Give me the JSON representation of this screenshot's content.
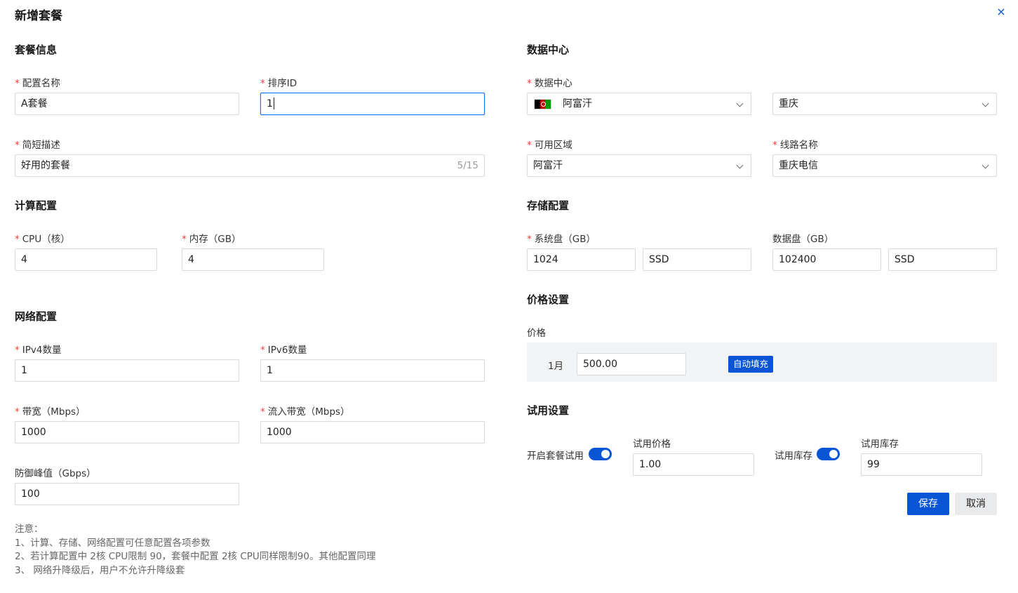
{
  "dialog": {
    "title": "新增套餐",
    "close": "×"
  },
  "package_info": {
    "title": "套餐信息",
    "name": {
      "label": "配置名称",
      "value": "A套餐"
    },
    "sort_id": {
      "label": "排序ID",
      "value": "1"
    },
    "description": {
      "label": "简短描述",
      "value": "好用的套餐",
      "counter": "5/15"
    }
  },
  "datacenter": {
    "title": "数据中心",
    "label": "数据中心",
    "country": "阿富汗",
    "city": "重庆",
    "zone": {
      "label": "可用区域",
      "value": "阿富汗"
    },
    "line": {
      "label": "线路名称",
      "value": "重庆电信"
    }
  },
  "compute": {
    "title": "计算配置",
    "cpu": {
      "label": "CPU（核）",
      "value": "4"
    },
    "memory": {
      "label": "内存（GB）",
      "value": "4"
    }
  },
  "storage": {
    "title": "存储配置",
    "system_disk": {
      "label": "系统盘（GB）",
      "value": "1024",
      "type": "SSD"
    },
    "data_disk": {
      "label": "数据盘（GB）",
      "value": "102400",
      "type": "SSD"
    }
  },
  "network": {
    "title": "网络配置",
    "ipv4": {
      "label": "IPv4数量",
      "value": "1"
    },
    "ipv6": {
      "label": "IPv6数量",
      "value": "1"
    },
    "bandwidth": {
      "label": "带宽（Mbps）",
      "value": "1000"
    },
    "inbound": {
      "label": "流入带宽（Mbps）",
      "value": "1000"
    },
    "ddos": {
      "label": "防御峰值（Gbps）",
      "value": "100"
    }
  },
  "price": {
    "title": "价格设置",
    "label": "价格",
    "period": "1月",
    "value": "500.00",
    "autofill": "自动填充"
  },
  "trial": {
    "title": "试用设置",
    "enable_label": "开启套餐试用",
    "enable_on": true,
    "price_label": "试用价格",
    "price_value": "1.00",
    "stock_toggle_label": "试用库存",
    "stock_on": true,
    "stock_label": "试用库存",
    "stock_value": "99"
  },
  "actions": {
    "save": "保存",
    "cancel": "取消"
  },
  "notes": {
    "heading": "注意：",
    "items": [
      "1、计算、存储、网络配置可任意配置各项参数",
      "2、若计算配置中 2核 CPU限制 90，套餐中配置 2核 CPU同样限制90。其他配置同理",
      "3、 网络升降级后，用户不允许升降级套"
    ]
  },
  "colors": {
    "primary": "#0a55d6",
    "required": "#e5463c",
    "flag": [
      "#000000",
      "#be0000",
      "#009900"
    ]
  }
}
